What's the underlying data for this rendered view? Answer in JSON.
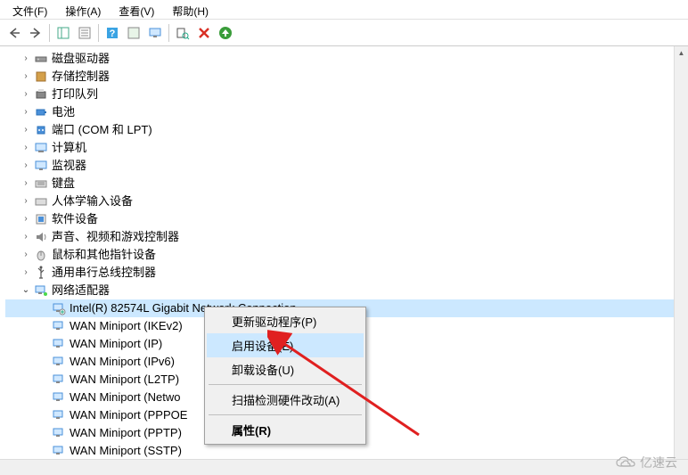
{
  "menubar": {
    "file": "文件(F)",
    "action": "操作(A)",
    "view": "查看(V)",
    "help": "帮助(H)"
  },
  "tree": {
    "disk_drives": "磁盘驱动器",
    "storage_controllers": "存储控制器",
    "print_queues": "打印队列",
    "batteries": "电池",
    "ports": "端口 (COM 和 LPT)",
    "computer": "计算机",
    "monitors": "监视器",
    "keyboards": "键盘",
    "hid": "人体学输入设备",
    "software": "软件设备",
    "sound": "声音、视频和游戏控制器",
    "mice": "鼠标和其他指针设备",
    "usb": "通用串行总线控制器",
    "network_adapters": "网络适配器",
    "adapters": [
      "Intel(R) 82574L Gigabit Network Connection",
      "WAN Miniport (IKEv2)",
      "WAN Miniport (IP)",
      "WAN Miniport (IPv6)",
      "WAN Miniport (L2TP)",
      "WAN Miniport (Netwo",
      "WAN Miniport (PPPOE",
      "WAN Miniport (PPTP)",
      "WAN Miniport (SSTP)"
    ]
  },
  "context_menu": {
    "update_driver": "更新驱动程序(P)",
    "enable_device": "启用设备(E)",
    "uninstall": "卸载设备(U)",
    "scan": "扫描检测硬件改动(A)",
    "properties": "属性(R)"
  },
  "watermark": "亿速云"
}
